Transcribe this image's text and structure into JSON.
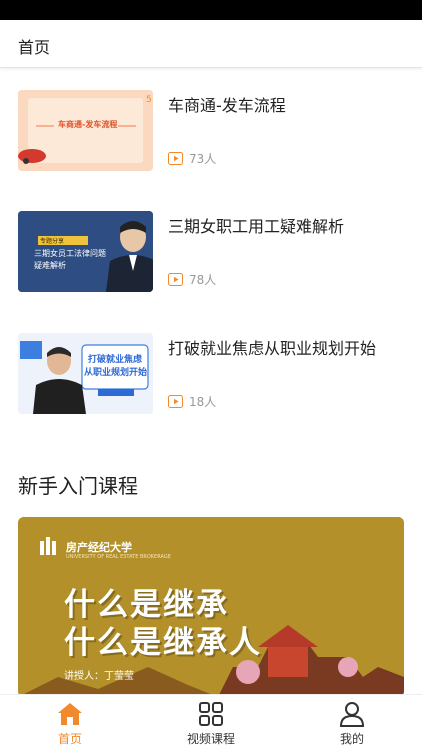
{
  "header": {
    "title": "首页"
  },
  "courses": [
    {
      "title": "车商通-发车流程",
      "count": "73人",
      "thumb_text": "车商通-发车流程"
    },
    {
      "title": "三期女职工用工疑难解析",
      "count": "78人",
      "thumb_tag": "专题分享",
      "thumb_text1": "三期女员工法律问题",
      "thumb_text2": "疑难解析"
    },
    {
      "title": "打破就业焦虑从职业规划开始",
      "count": "18人",
      "thumb_text1": "打破就业焦虑",
      "thumb_text2": "从职业规划开始"
    }
  ],
  "section": {
    "title": "新手入门课程"
  },
  "banner": {
    "logo": "房产经纪大学",
    "logo_sub": "UNIVERSITY OF REAL ESTATE BROKERAGE",
    "title1": "什么是继承",
    "title2": "什么是继承人",
    "lecturer": "讲授人：丁莹莹"
  },
  "tabs": [
    {
      "label": "首页",
      "icon": "home-icon"
    },
    {
      "label": "视频课程",
      "icon": "grid-icon"
    },
    {
      "label": "我的",
      "icon": "user-icon"
    }
  ],
  "colors": {
    "accent": "#f08a2c",
    "banner_bg": "#b3902a"
  }
}
